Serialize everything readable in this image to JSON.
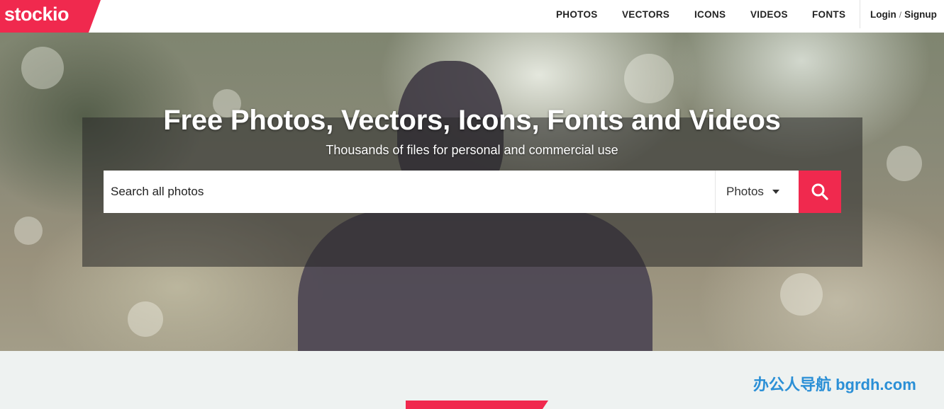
{
  "logo": {
    "text": "stockio"
  },
  "nav": {
    "items": [
      {
        "label": "PHOTOS"
      },
      {
        "label": "VECTORS"
      },
      {
        "label": "ICONS"
      },
      {
        "label": "VIDEOS"
      },
      {
        "label": "FONTS"
      }
    ],
    "login_label": "Login",
    "separator": "/",
    "signup_label": "Signup"
  },
  "hero": {
    "title": "Free Photos, Vectors, Icons, Fonts and Videos",
    "subtitle": "Thousands of files for personal and commercial use"
  },
  "search": {
    "placeholder": "Search all photos",
    "value": "",
    "type_selected": "Photos",
    "button_icon": "search-icon"
  },
  "watermark": {
    "text": "办公人导航 bgrdh.com"
  },
  "colors": {
    "brand": "#f0294e",
    "watermark": "#2a8fd6"
  }
}
